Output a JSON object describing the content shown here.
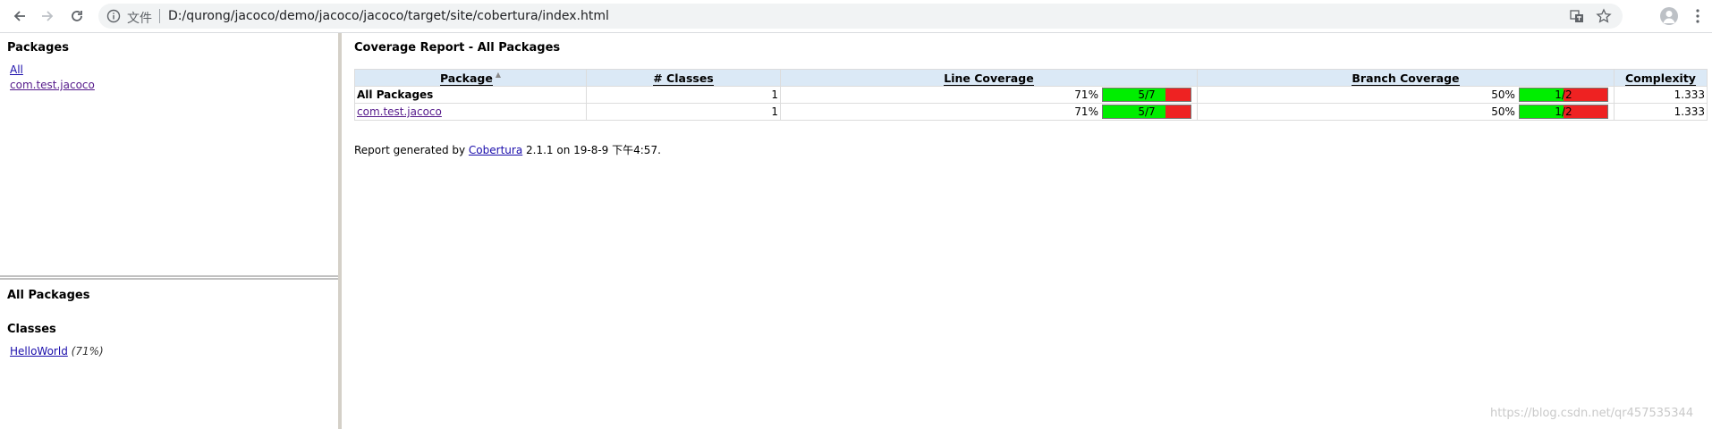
{
  "browser": {
    "file_label": "文件",
    "url": "D:/qurong/jacoco/demo/jacoco/jacoco/target/site/cobertura/index.html"
  },
  "packages_frame": {
    "title": "Packages",
    "links": [
      "All",
      "com.test.jacoco"
    ]
  },
  "classes_frame": {
    "title": "All Packages",
    "classes_heading": "Classes",
    "classes": [
      {
        "name": "HelloWorld",
        "pct": "(71%)"
      }
    ]
  },
  "report": {
    "title": "Coverage Report - All Packages",
    "columns": [
      "Package",
      "# Classes",
      "Line Coverage",
      "Branch Coverage",
      "Complexity"
    ],
    "rows": [
      {
        "package": "All Packages",
        "classes": "1",
        "line_pct": "71%",
        "line_ratio": "5/7",
        "line_fraction": 0.714,
        "branch_pct": "50%",
        "branch_ratio": "1/2",
        "branch_fraction": 0.5,
        "complexity": "1.333"
      },
      {
        "package": "com.test.jacoco",
        "classes": "1",
        "line_pct": "71%",
        "line_ratio": "5/7",
        "line_fraction": 0.714,
        "branch_pct": "50%",
        "branch_ratio": "1/2",
        "branch_fraction": 0.5,
        "complexity": "1.333"
      }
    ],
    "footer_prefix": "Report generated by ",
    "footer_link": "Cobertura",
    "footer_suffix": " 2.1.1 on 19-8-9 下午4:57."
  },
  "watermark": "https://blog.csdn.net/qr457535344",
  "colors": {
    "covered": "#00ee00",
    "uncovered": "#ee2222",
    "header_bg": "#dbe9f6"
  }
}
